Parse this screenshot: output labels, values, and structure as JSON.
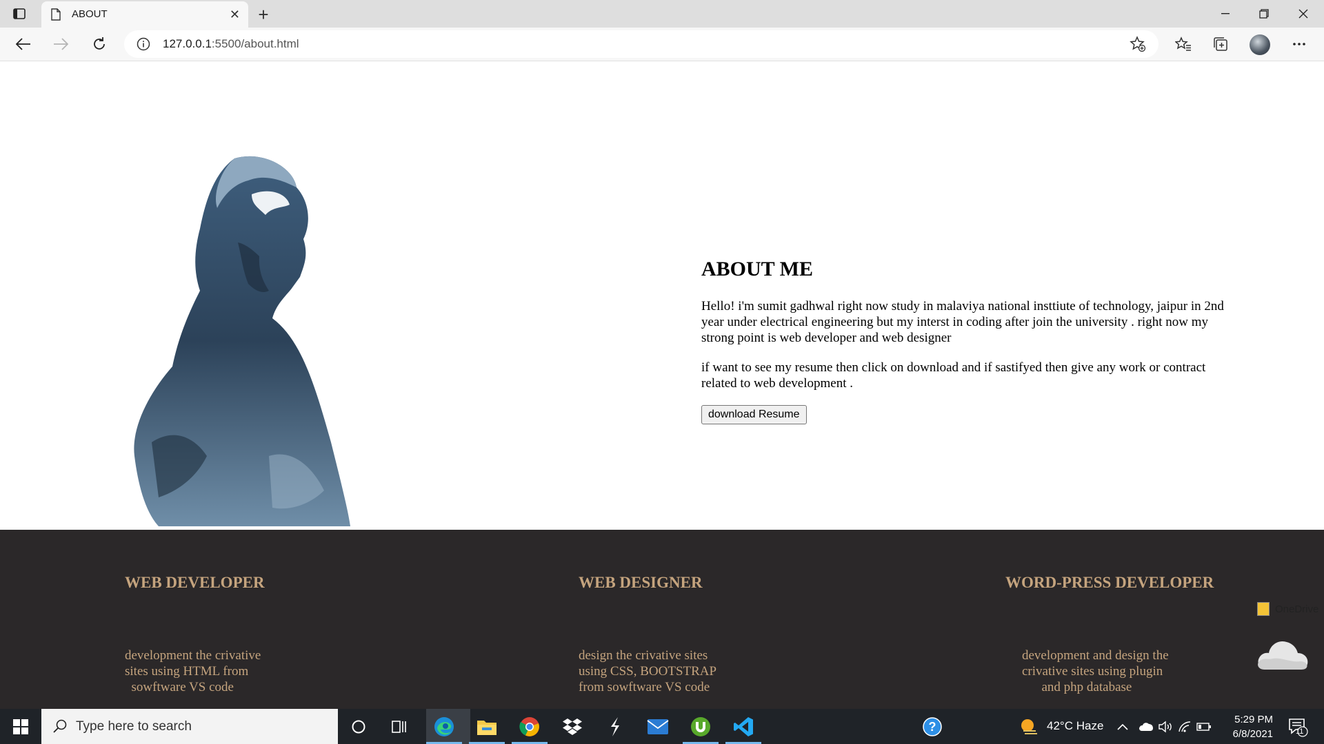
{
  "browser": {
    "tab_title": "ABOUT",
    "url_host": "127.0.0.1",
    "url_rest": ":5500/about.html"
  },
  "about": {
    "heading": "ABOUT ME",
    "paragraph1": "Hello! i'm sumit gadhwal right now study in malaviya national insttiute of technology, jaipur in 2nd year under electrical engineering but my interst in coding after join the university . right now my strong point is web developer and web designer",
    "paragraph2": "if want to see my resume then click on download and if sastifyed then give any work or contract related to web development .",
    "download_label": "download Resume"
  },
  "services": [
    {
      "title": "WEB DEVELOPER",
      "desc_lines": [
        "development the crivative",
        "sites using HTML from",
        "  sowftware VS code"
      ]
    },
    {
      "title": "WEB DESIGNER",
      "desc_lines": [
        "design the crivative sites",
        "using CSS, BOOTSTRAP",
        "from sowftware VS code"
      ]
    },
    {
      "title": "WORD-PRESS DEVELOPER",
      "desc_lines": [
        "development and design the",
        "crivative sites using plugin",
        "      and php database"
      ]
    }
  ],
  "onedrive": {
    "label": "OneDrive"
  },
  "taskbar": {
    "search_placeholder": "Type here to search",
    "weather": "42°C  Haze",
    "time": "5:29 PM",
    "date": "6/8/2021",
    "notification_count": "11",
    "icons": [
      "windows-start-icon",
      "cortana-icon",
      "task-view-icon",
      "edge-icon",
      "file-explorer-icon",
      "chrome-icon",
      "dropbox-icon",
      "stripe-icon",
      "mail-icon",
      "utorrent-icon",
      "vscode-icon",
      "help-icon"
    ]
  }
}
